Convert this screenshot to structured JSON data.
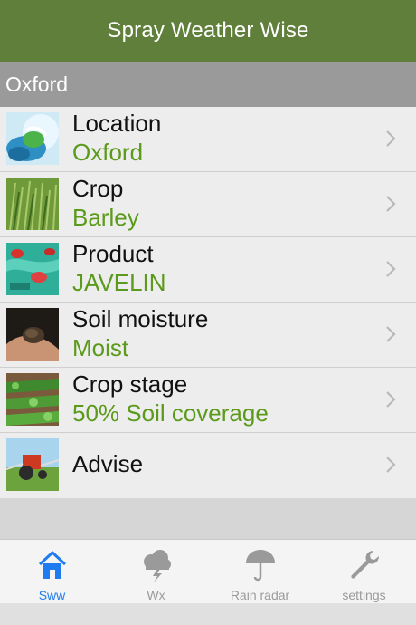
{
  "navbar": {
    "title": "Spray Weather Wise"
  },
  "section": {
    "title": "Oxford"
  },
  "rows": [
    {
      "title": "Location",
      "value": "Oxford",
      "icon": "location-photo-icon"
    },
    {
      "title": "Crop",
      "value": "Barley",
      "icon": "crop-photo-icon"
    },
    {
      "title": "Product",
      "value": "JAVELIN",
      "icon": "product-photo-icon"
    },
    {
      "title": "Soil moisture",
      "value": "Moist",
      "icon": "soil-photo-icon"
    },
    {
      "title": "Crop stage",
      "value": "50% Soil coverage",
      "icon": "crop-stage-photo-icon"
    },
    {
      "title": "Advise",
      "icon": "tractor-photo-icon"
    }
  ],
  "tabs": [
    {
      "label": "Sww",
      "icon": "home-icon",
      "active": true
    },
    {
      "label": "Wx",
      "icon": "storm-cloud-icon",
      "active": false
    },
    {
      "label": "Rain radar",
      "icon": "umbrella-icon",
      "active": false
    },
    {
      "label": "settings",
      "icon": "wrench-icon",
      "active": false
    }
  ],
  "colors": {
    "navbar": "#5f7f3a",
    "value_text": "#5b9a1a",
    "active_tab": "#1e7cf0",
    "inactive_tab": "#9a9a9a"
  }
}
